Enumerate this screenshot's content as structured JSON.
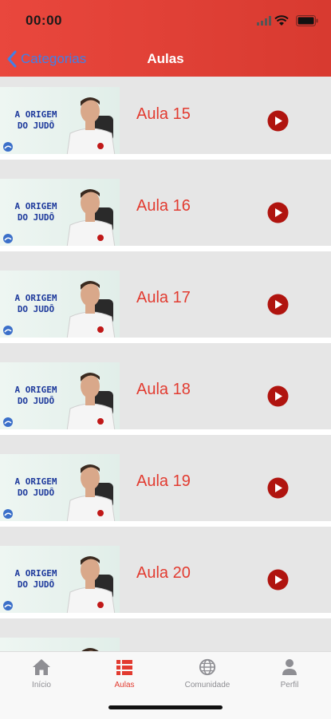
{
  "status_bar": {
    "time": "00:00"
  },
  "nav": {
    "back_label": "Categorias",
    "title": "Aulas"
  },
  "thumbnail": {
    "line1": "A ORIGEM",
    "line2": "DO JUDÔ"
  },
  "lessons": [
    {
      "title": "Aula 15"
    },
    {
      "title": "Aula 16"
    },
    {
      "title": "Aula 17"
    },
    {
      "title": "Aula 18"
    },
    {
      "title": "Aula 19"
    },
    {
      "title": "Aula 20"
    },
    {
      "title": ""
    }
  ],
  "tabs": [
    {
      "label": "Início",
      "icon": "home-icon",
      "active": false
    },
    {
      "label": "Aulas",
      "icon": "list-icon",
      "active": true
    },
    {
      "label": "Comunidade",
      "icon": "globe-icon",
      "active": false
    },
    {
      "label": "Perfil",
      "icon": "person-icon",
      "active": false
    }
  ],
  "colors": {
    "header": "#e9473d",
    "accent": "#e23b30",
    "play": "#b0140f",
    "back": "#3f80e8"
  }
}
